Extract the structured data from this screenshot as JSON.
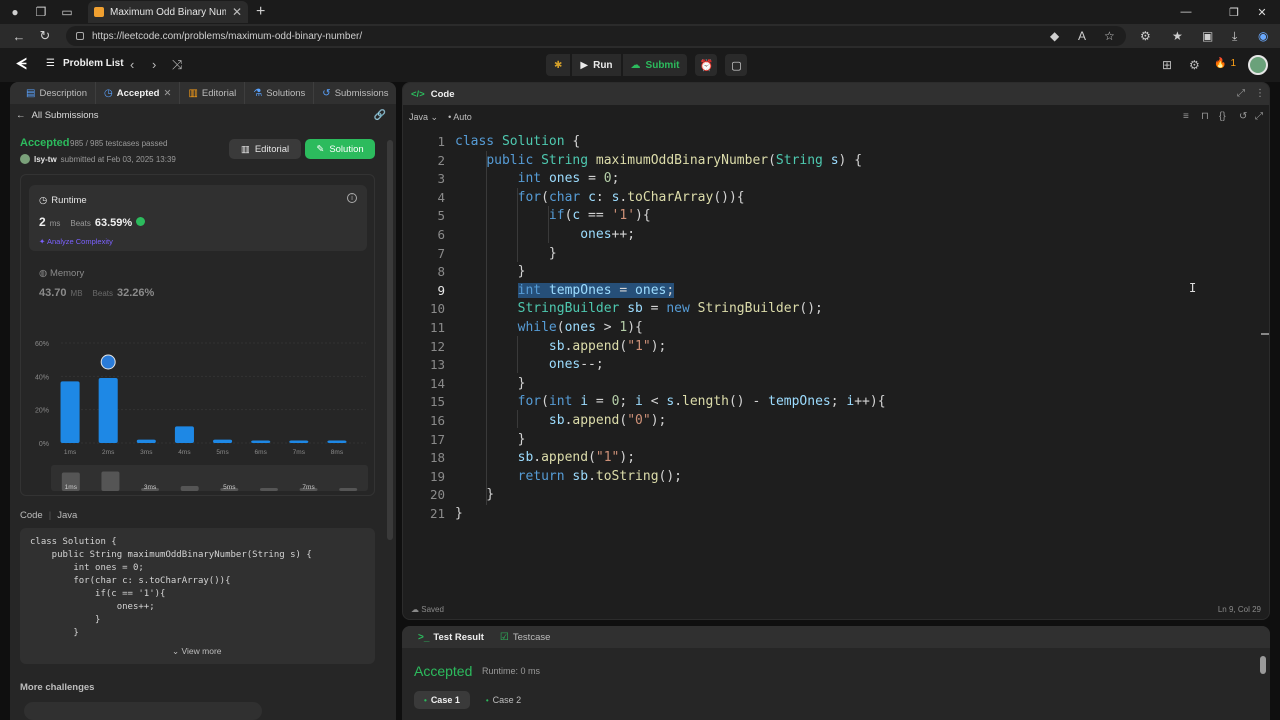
{
  "browser": {
    "tab_title": "Maximum Odd Binary Number - L",
    "url": "https://leetcode.com/problems/maximum-odd-binary-number/"
  },
  "nav": {
    "problem_list": "Problem List",
    "run": "Run",
    "submit": "Submit",
    "streak": "1"
  },
  "left_tabs": [
    {
      "label": "Description",
      "icon": "document-icon"
    },
    {
      "label": "Accepted",
      "icon": "clock-icon"
    },
    {
      "label": "Editorial",
      "icon": "book-icon"
    },
    {
      "label": "Solutions",
      "icon": "flask-icon"
    },
    {
      "label": "Submissions",
      "icon": "history-icon"
    }
  ],
  "submission": {
    "all_submissions": "All Submissions",
    "status": "Accepted",
    "testcases": "985 / 985 testcases passed",
    "user": "lsy-tw",
    "submitted_at": "submitted at Feb 03, 2025 13:39",
    "editorial_btn": "Editorial",
    "solution_btn": "Solution"
  },
  "runtime": {
    "label": "Runtime",
    "value": "2",
    "unit": "ms",
    "beats_label": "Beats",
    "beats": "63.59%",
    "analyze": "Analyze Complexity"
  },
  "memory": {
    "label": "Memory",
    "value": "43.70",
    "unit": "MB",
    "beats_label": "Beats",
    "beats": "32.26%"
  },
  "chart_data": {
    "type": "bar",
    "categories": [
      "1ms",
      "2ms",
      "3ms",
      "4ms",
      "5ms",
      "6ms",
      "7ms",
      "8ms"
    ],
    "values": [
      37,
      39,
      2,
      10,
      2,
      1.5,
      1.5,
      1.5
    ],
    "highlight_index": 1,
    "ylim": [
      0,
      60
    ],
    "yticks": [
      "60%",
      "40%",
      "20%",
      "0%"
    ],
    "ytick_values": [
      60,
      40,
      20,
      0
    ],
    "minimap_labels": [
      "1ms",
      "3ms",
      "5ms",
      "7ms"
    ],
    "bar_color": "#1e88e5"
  },
  "code_section": {
    "label": "Code",
    "lang": "Java",
    "view_more": "View more",
    "more_challenges": "More challenges",
    "preview": "class Solution {\n    public String maximumOddBinaryNumber(String s) {\n        int ones = 0;\n        for(char c: s.toCharArray()){\n            if(c == '1'){\n                ones++;\n            }\n        }"
  },
  "editor": {
    "title": "Code",
    "language": "Java",
    "mode": "Auto",
    "saved": "Saved",
    "position": "Ln 9, Col 29"
  },
  "result": {
    "tab_result": "Test Result",
    "tab_testcase": "Testcase",
    "status": "Accepted",
    "runtime": "Runtime: 0 ms",
    "cases": [
      "Case 1",
      "Case 2"
    ]
  }
}
